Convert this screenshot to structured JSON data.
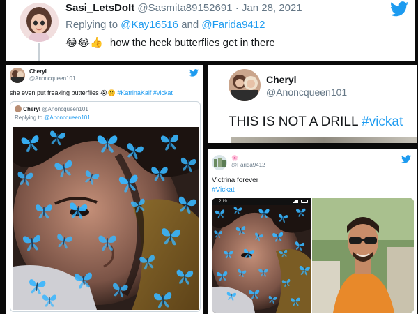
{
  "top_tweet": {
    "display_name": "Sasi_LetsDoIt",
    "handle": "@Sasmita89152691",
    "separator": "·",
    "date": "Jan 28, 2021",
    "replying_prefix": "Replying to",
    "reply_to_1": "@Kay16516",
    "and_word": "and",
    "reply_to_2": "@Farida9412",
    "emojis": "😂😂👍",
    "text": "how the heck butterflies get in there"
  },
  "left_tweet": {
    "display_name": "Cheryl",
    "handle": "@Anoncqueen101",
    "text_prefix": "she even put freaking butterflies",
    "text_emojis": "😭🤫",
    "hashtag_1": "#KatrinaKaif",
    "hashtag_2": "#vickat",
    "quoted": {
      "display_name": "Cheryl",
      "handle": "@Anoncqueen101",
      "replying_prefix": "Replying to",
      "reply_to": "@Anoncqueen101"
    }
  },
  "right_top_tweet": {
    "display_name": "Cheryl",
    "handle": "@Anoncqueen101",
    "text": "THIS IS NOT A DRILL",
    "hashtag": "#vickat"
  },
  "right_bottom_tweet": {
    "name_emoji": "🌸",
    "handle": "@Farida9412",
    "line_1": "Victrina forever",
    "hashtag": "#Vickat",
    "status_time": "2:19"
  },
  "colors": {
    "twitter_blue": "#1d9bf0",
    "butterfly_blue": "#38b6ff",
    "text_dark": "#14171a",
    "muted_gray": "#657786",
    "orange_shirt": "#e8892a"
  },
  "icons": [
    "twitter-bird-icon",
    "butterfly-icon",
    "thread-line",
    "battery-icon",
    "signal-icon"
  ]
}
